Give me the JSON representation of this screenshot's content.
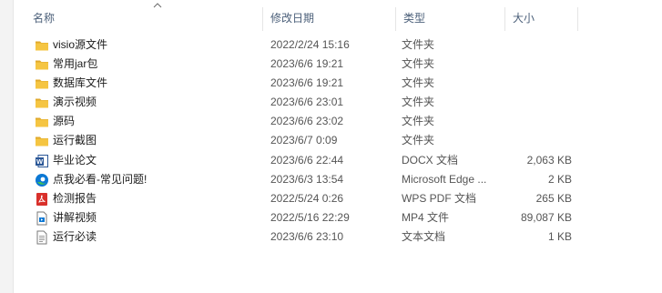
{
  "columns": {
    "name": "名称",
    "date": "修改日期",
    "type": "类型",
    "size": "大小"
  },
  "files": [
    {
      "name": "visio源文件",
      "date": "2022/2/24 15:16",
      "type": "文件夹",
      "size": "",
      "icon": "folder-icon"
    },
    {
      "name": "常用jar包",
      "date": "2023/6/6 19:21",
      "type": "文件夹",
      "size": "",
      "icon": "folder-icon"
    },
    {
      "name": "数据库文件",
      "date": "2023/6/6 19:21",
      "type": "文件夹",
      "size": "",
      "icon": "folder-icon"
    },
    {
      "name": "演示视频",
      "date": "2023/6/6 23:01",
      "type": "文件夹",
      "size": "",
      "icon": "folder-icon"
    },
    {
      "name": "源码",
      "date": "2023/6/6 23:02",
      "type": "文件夹",
      "size": "",
      "icon": "folder-icon"
    },
    {
      "name": "运行截图",
      "date": "2023/6/7 0:09",
      "type": "文件夹",
      "size": "",
      "icon": "folder-icon"
    },
    {
      "name": "毕业论文",
      "date": "2023/6/6 22:44",
      "type": "DOCX 文档",
      "size": "2,063 KB",
      "icon": "word-document-icon"
    },
    {
      "name": "点我必看-常见问题!",
      "date": "2023/6/3 13:54",
      "type": "Microsoft Edge ...",
      "size": "2 KB",
      "icon": "edge-browser-icon"
    },
    {
      "name": "检测报告",
      "date": "2022/5/24 0:26",
      "type": "WPS PDF 文档",
      "size": "265 KB",
      "icon": "pdf-document-icon"
    },
    {
      "name": "讲解视频",
      "date": "2022/5/16 22:29",
      "type": "MP4 文件",
      "size": "89,087 KB",
      "icon": "video-file-icon"
    },
    {
      "name": "运行必读",
      "date": "2023/6/6 23:10",
      "type": "文本文档",
      "size": "1 KB",
      "icon": "text-file-icon"
    }
  ],
  "colors": {
    "folder": "#f5c542",
    "folder_dark": "#e0a92c",
    "word": "#2b5797",
    "pdf": "#d9302b",
    "edge_blue": "#0c78d4",
    "edge_green": "#3fbf5a",
    "header_text": "#4c607a"
  }
}
